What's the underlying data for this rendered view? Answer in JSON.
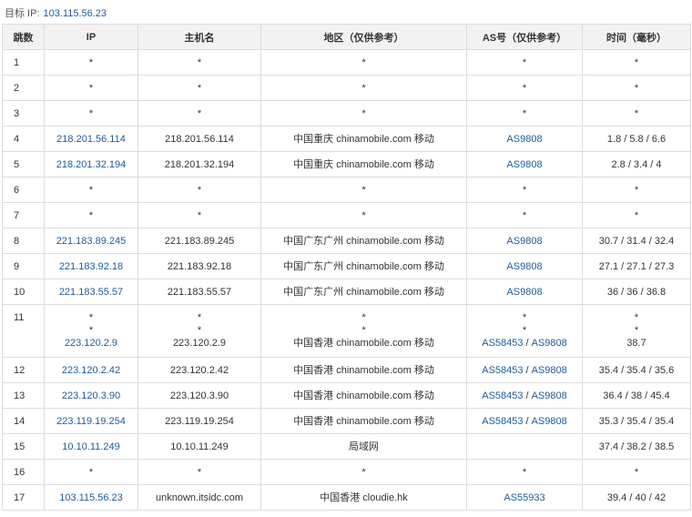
{
  "target": {
    "label": "目标 IP:",
    "ip": "103.115.56.23"
  },
  "headers": [
    "跳数",
    "IP",
    "主机名",
    "地区（仅供参考）",
    "AS号（仅供参考）",
    "时间（毫秒）"
  ],
  "rows": [
    {
      "hop": "1",
      "ip": [
        "*"
      ],
      "host": [
        "*"
      ],
      "region": [
        "*"
      ],
      "as": [
        [
          "*"
        ]
      ],
      "time": [
        "*"
      ]
    },
    {
      "hop": "2",
      "ip": [
        "*"
      ],
      "host": [
        "*"
      ],
      "region": [
        "*"
      ],
      "as": [
        [
          "*"
        ]
      ],
      "time": [
        "*"
      ]
    },
    {
      "hop": "3",
      "ip": [
        "*"
      ],
      "host": [
        "*"
      ],
      "region": [
        "*"
      ],
      "as": [
        [
          "*"
        ]
      ],
      "time": [
        "*"
      ]
    },
    {
      "hop": "4",
      "ip": [
        "218.201.56.114"
      ],
      "host": [
        "218.201.56.114"
      ],
      "region": [
        "中国重庆 chinamobile.com 移动"
      ],
      "as": [
        [
          "AS9808"
        ]
      ],
      "time": [
        "1.8 / 5.8 / 6.6"
      ]
    },
    {
      "hop": "5",
      "ip": [
        "218.201.32.194"
      ],
      "host": [
        "218.201.32.194"
      ],
      "region": [
        "中国重庆 chinamobile.com 移动"
      ],
      "as": [
        [
          "AS9808"
        ]
      ],
      "time": [
        "2.8 / 3.4 / 4"
      ]
    },
    {
      "hop": "6",
      "ip": [
        "*"
      ],
      "host": [
        "*"
      ],
      "region": [
        "*"
      ],
      "as": [
        [
          "*"
        ]
      ],
      "time": [
        "*"
      ]
    },
    {
      "hop": "7",
      "ip": [
        "*"
      ],
      "host": [
        "*"
      ],
      "region": [
        "*"
      ],
      "as": [
        [
          "*"
        ]
      ],
      "time": [
        "*"
      ]
    },
    {
      "hop": "8",
      "ip": [
        "221.183.89.245"
      ],
      "host": [
        "221.183.89.245"
      ],
      "region": [
        "中国广东广州 chinamobile.com 移动"
      ],
      "as": [
        [
          "AS9808"
        ]
      ],
      "time": [
        "30.7 / 31.4 / 32.4"
      ]
    },
    {
      "hop": "9",
      "ip": [
        "221.183.92.18"
      ],
      "host": [
        "221.183.92.18"
      ],
      "region": [
        "中国广东广州 chinamobile.com 移动"
      ],
      "as": [
        [
          "AS9808"
        ]
      ],
      "time": [
        "27.1 / 27.1 / 27.3"
      ]
    },
    {
      "hop": "10",
      "ip": [
        "221.183.55.57"
      ],
      "host": [
        "221.183.55.57"
      ],
      "region": [
        "中国广东广州 chinamobile.com 移动"
      ],
      "as": [
        [
          "AS9808"
        ]
      ],
      "time": [
        "36 / 36 / 36.8"
      ]
    },
    {
      "hop": "11",
      "ip": [
        "*",
        "*",
        "223.120.2.9"
      ],
      "host": [
        "*",
        "*",
        "223.120.2.9"
      ],
      "region": [
        "*",
        "*",
        "中国香港 chinamobile.com 移动"
      ],
      "as": [
        [
          "*"
        ],
        [
          "*"
        ],
        [
          "AS58453",
          "AS9808"
        ]
      ],
      "time": [
        "*",
        "*",
        "38.7"
      ]
    },
    {
      "hop": "12",
      "ip": [
        "223.120.2.42"
      ],
      "host": [
        "223.120.2.42"
      ],
      "region": [
        "中国香港 chinamobile.com 移动"
      ],
      "as": [
        [
          "AS58453",
          "AS9808"
        ]
      ],
      "time": [
        "35.4 / 35.4 / 35.6"
      ]
    },
    {
      "hop": "13",
      "ip": [
        "223.120.3.90"
      ],
      "host": [
        "223.120.3.90"
      ],
      "region": [
        "中国香港 chinamobile.com 移动"
      ],
      "as": [
        [
          "AS58453",
          "AS9808"
        ]
      ],
      "time": [
        "36.4 / 38 / 45.4"
      ]
    },
    {
      "hop": "14",
      "ip": [
        "223.119.19.254"
      ],
      "host": [
        "223.119.19.254"
      ],
      "region": [
        "中国香港 chinamobile.com 移动"
      ],
      "as": [
        [
          "AS58453",
          "AS9808"
        ]
      ],
      "time": [
        "35.3 / 35.4 / 35.4"
      ]
    },
    {
      "hop": "15",
      "ip": [
        "10.10.11.249"
      ],
      "host": [
        "10.10.11.249"
      ],
      "region": [
        "局域网"
      ],
      "as": [
        [
          ""
        ]
      ],
      "time": [
        "37.4 / 38.2 / 38.5"
      ]
    },
    {
      "hop": "16",
      "ip": [
        "*"
      ],
      "host": [
        "*"
      ],
      "region": [
        "*"
      ],
      "as": [
        [
          "*"
        ]
      ],
      "time": [
        "*"
      ]
    },
    {
      "hop": "17",
      "ip": [
        "103.115.56.23"
      ],
      "host": [
        "unknown.itsidc.com"
      ],
      "region": [
        "中国香港 cloudie.hk"
      ],
      "as": [
        [
          "AS55933"
        ]
      ],
      "time": [
        "39.4 / 40 / 42"
      ]
    }
  ]
}
